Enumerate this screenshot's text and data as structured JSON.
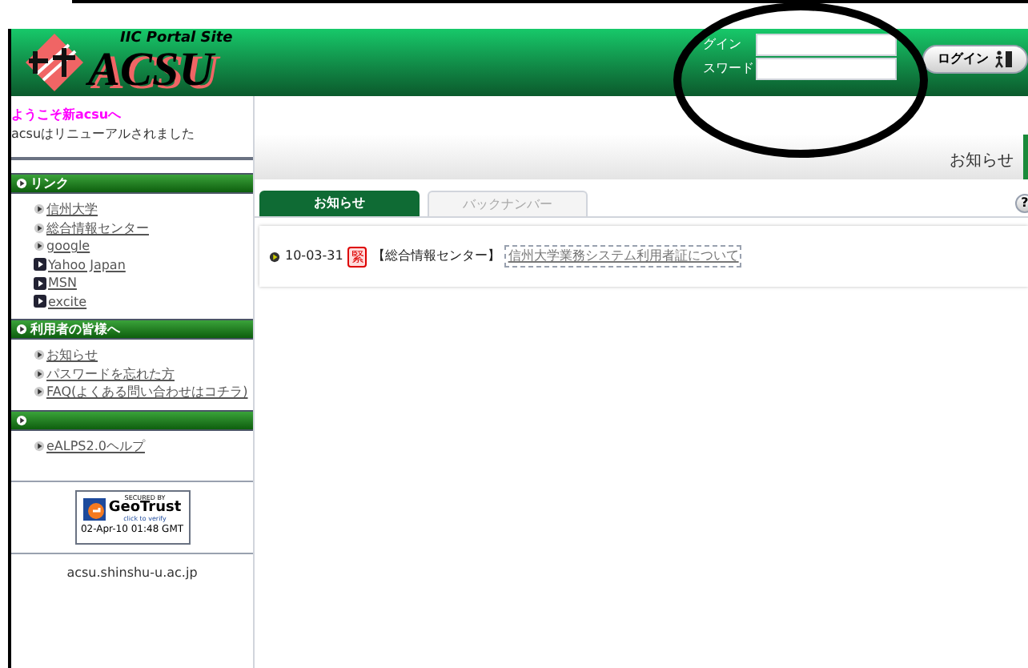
{
  "header": {
    "subtitle": "IIC Portal Site",
    "logo": "ACSU"
  },
  "login": {
    "user_label": "グイン",
    "password_label": "スワード",
    "button": "ログイン"
  },
  "sidebar": {
    "welcome_title": "ようこそ新acsuへ",
    "welcome_text": "acsuはリニューアルされました",
    "sections": [
      {
        "title": "リンク",
        "items": [
          {
            "label": "信州大学",
            "kind": "internal"
          },
          {
            "label": "総合情報センター",
            "kind": "internal"
          },
          {
            "label": "google",
            "kind": "internal"
          },
          {
            "label": "Yahoo Japan",
            "kind": "external"
          },
          {
            "label": "MSN",
            "kind": "external"
          },
          {
            "label": "excite",
            "kind": "external"
          }
        ]
      },
      {
        "title": "利用者の皆様へ",
        "items": [
          {
            "label": "お知らせ",
            "kind": "internal"
          },
          {
            "label": "パスワードを忘れた方",
            "kind": "internal"
          },
          {
            "label": "FAQ(よくある問い合わせはコチラ)",
            "kind": "internal"
          }
        ]
      },
      {
        "items": [
          {
            "label": "eALPS2.0ヘルプ",
            "kind": "internal"
          }
        ]
      }
    ],
    "seal": {
      "line1": "SECURED BY",
      "brand": "GeoTrust",
      "line2": "click to verify",
      "date": "02-Apr-10 01:48 GMT"
    },
    "footer": "acsu.shinshu-u.ac.jp"
  },
  "content": {
    "heading": "お知らせ",
    "tabs": [
      {
        "label": "お知らせ",
        "selected": true
      },
      {
        "label": "バックナンバー",
        "selected": false
      }
    ],
    "help": "?",
    "news": [
      {
        "date": "10-03-31",
        "badge": "緊",
        "source": "【総合情報センター】",
        "title": "信州大学業務システム利用者証について"
      }
    ]
  }
}
